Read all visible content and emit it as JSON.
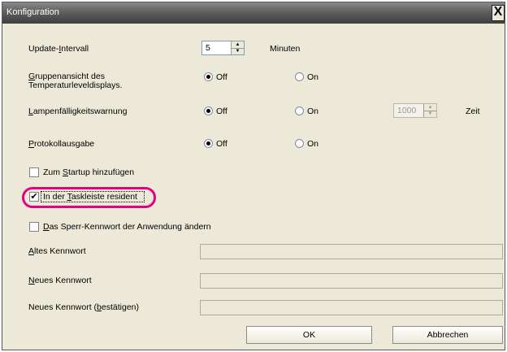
{
  "window": {
    "title": "Konfiguration",
    "close_label": "X"
  },
  "update_interval": {
    "label": "Update-Intervall",
    "value": "5",
    "unit": "Minuten"
  },
  "group_view": {
    "label_line1": "Gruppenansicht des",
    "label_line2": "Temperaturleveldisplays.",
    "off_label": "Off",
    "on_label": "On",
    "selected": "Off"
  },
  "lamp_warning": {
    "label": "Lampenfälligkeitswarnung",
    "off_label": "Off",
    "on_label": "On",
    "selected": "Off",
    "time_value": "1000",
    "time_label": "Zeit"
  },
  "log_output": {
    "label": "Protokollausgabe",
    "off_label": "Off",
    "on_label": "On",
    "selected": "Off"
  },
  "startup": {
    "label": "Zum Startup hinzufügen",
    "checked": false
  },
  "taskbar": {
    "label": "In der Taskleiste resident",
    "checked": true,
    "check_mark": "✔"
  },
  "change_password": {
    "label": "Das Sperr-Kennwort der Anwendung ändern",
    "checked": false
  },
  "passwords": {
    "old_label": "Altes Kennwort",
    "new_label": "Neues Kennwort",
    "confirm_label": "Neues Kennwort (bestätigen)"
  },
  "buttons": {
    "ok": "OK",
    "cancel": "Abbrechen"
  },
  "colors": {
    "highlight": "#e4007f",
    "dialog_bg": "#ece9d8"
  }
}
